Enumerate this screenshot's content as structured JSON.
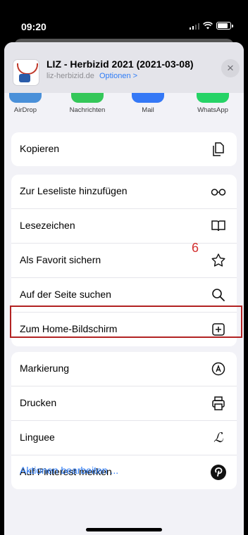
{
  "status_bar": {
    "time": "09:20"
  },
  "share_header": {
    "title": "LIZ - Herbizid 2021 (2021-03-08)",
    "domain": "liz-herbizid.de",
    "options_link": "Optionen >",
    "close_symbol": "×"
  },
  "apps": [
    {
      "label": "AirDrop",
      "color": "#4a90d9"
    },
    {
      "label": "Nachrichten",
      "color": "#34c759"
    },
    {
      "label": "Mail",
      "color": "#3478f6"
    },
    {
      "label": "WhatsApp",
      "color": "#25d366"
    }
  ],
  "actions": {
    "copy": "Kopieren",
    "reading_list": "Zur Leseliste hinzufügen",
    "bookmark": "Lesezeichen",
    "favorite": "Als Favorit sichern",
    "find_on_page": "Auf der Seite suchen",
    "add_home": "Zum Home-Bildschirm",
    "markup": "Markierung",
    "print": "Drucken",
    "linguee": "Linguee",
    "pinterest": "Auf Pinterest merken"
  },
  "annotation": {
    "step_number": "6",
    "color": "#b22222"
  },
  "edit_actions_link": "Aktionen bearbeiten ..."
}
